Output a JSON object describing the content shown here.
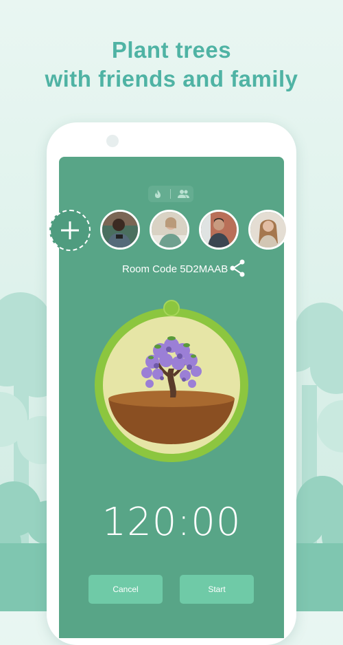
{
  "headline": {
    "line1": "Plant trees",
    "line2": "with friends and family"
  },
  "colors": {
    "accent": "#4fb3a4",
    "screen_bg": "#58a587",
    "button_bg": "#6fcaa7",
    "ring": "#8cc63f",
    "tree_flowers": "#9b7fd6"
  },
  "mode_toggle": {
    "icons": [
      "flame-icon",
      "people-icon"
    ]
  },
  "participants": {
    "add_icon": "plus-icon",
    "avatars": [
      "participant-1",
      "participant-2",
      "participant-3",
      "participant-4"
    ]
  },
  "room": {
    "label": "Room Code 5D2MAAB",
    "share_icon": "share-icon"
  },
  "timer": {
    "value": "120:00",
    "progress": 0
  },
  "buttons": {
    "cancel": "Cancel",
    "start": "Start"
  }
}
